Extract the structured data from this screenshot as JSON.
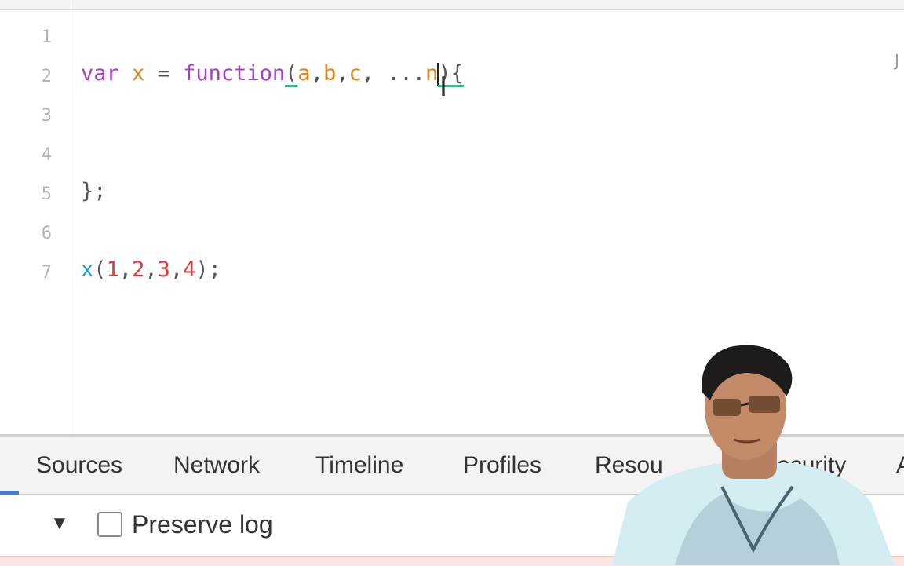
{
  "editor": {
    "line_numbers": [
      "1",
      "2",
      "3",
      "4",
      "5",
      "6",
      "7"
    ],
    "line2": {
      "kw_var": "var",
      "name": "x",
      "eq": "=",
      "kw_function": "function",
      "open_paren": "(",
      "p_a": "a",
      "comma1": ",",
      "p_b": "b",
      "comma2": ",",
      "p_c": "c",
      "comma3": ",",
      "spread": " ...",
      "p_n": "n",
      "close": "){"
    },
    "line5": "};",
    "line7": {
      "fn": "x",
      "open": "(",
      "n1": "1",
      "c1": ",",
      "n2": "2",
      "c2": ",",
      "n3": "3",
      "c3": ",",
      "n4": "4",
      "close": ");"
    },
    "edge_glyph": "J"
  },
  "devtools": {
    "tabs": [
      "Sources",
      "Network",
      "Timeline",
      "Profiles",
      "Resou",
      "Security",
      "A"
    ],
    "preserve_log_label": "Preserve log",
    "accent_color": "#3a7de8"
  },
  "icons": {
    "filter_toggle": "triangle-down-icon",
    "text_cursor": "i-beam-cursor-icon"
  }
}
